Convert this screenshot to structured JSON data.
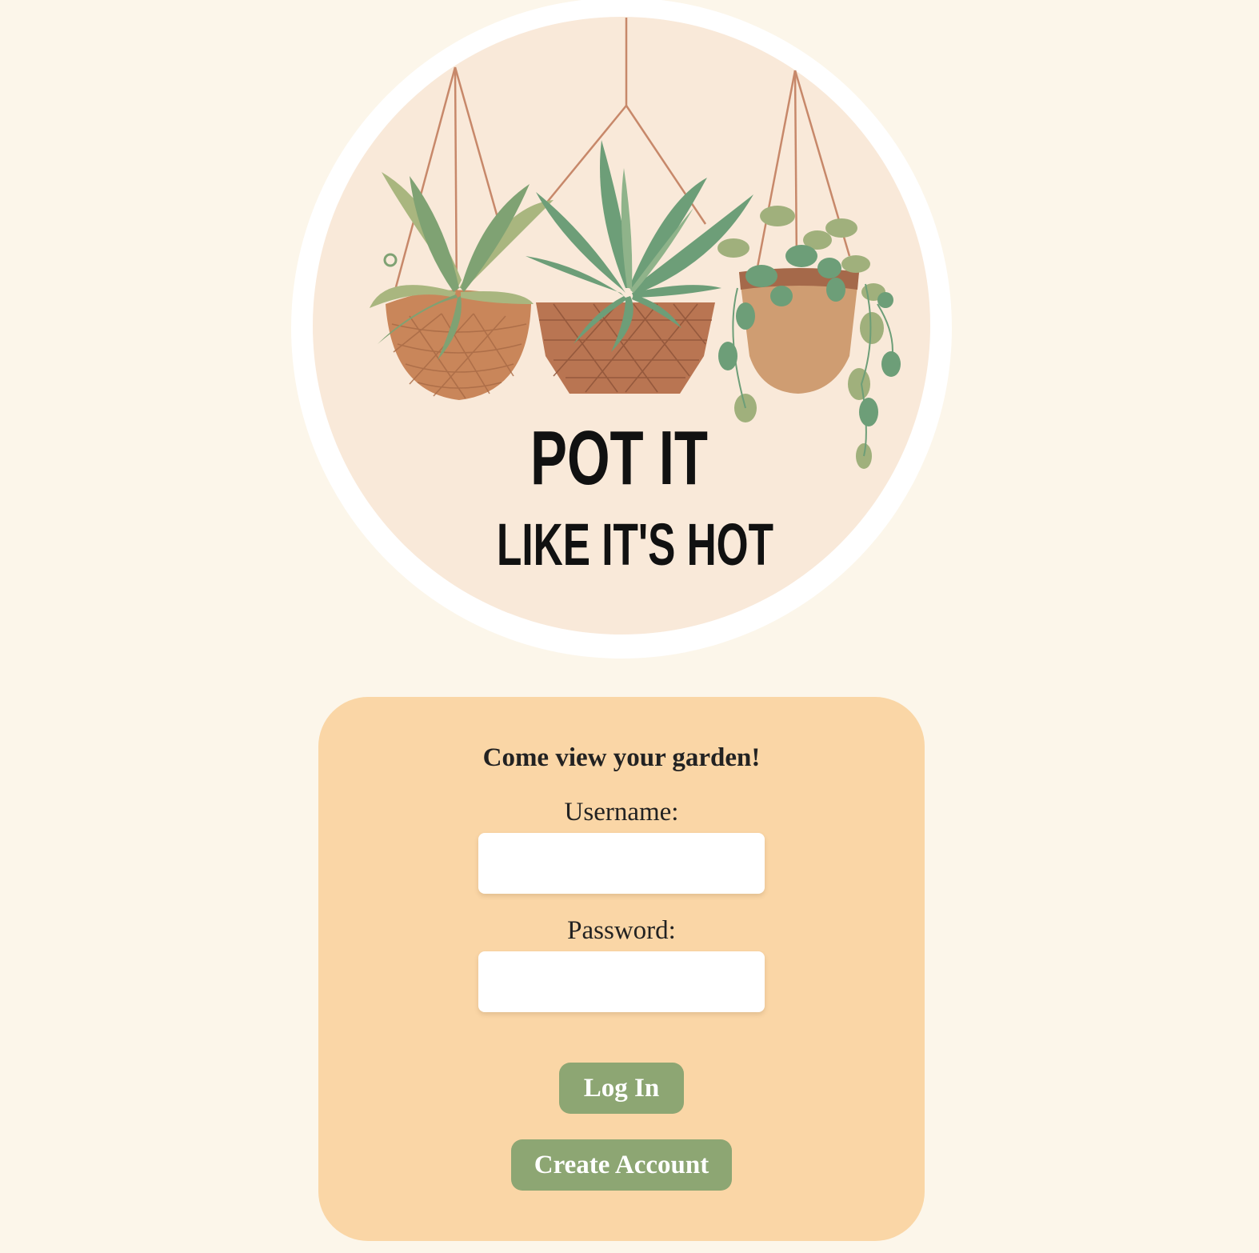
{
  "logo": {
    "title_line1": "POT IT",
    "title_line2": "LIKE IT'S HOT",
    "colors": {
      "outer_ring": "#ffffff",
      "badge": "#f9e9d9",
      "pot": "#c9865a",
      "leaf_dark": "#6d9e78",
      "leaf_light": "#a9b67f"
    }
  },
  "login_form": {
    "heading": "Come view your garden!",
    "username_label": "Username:",
    "username_value": "",
    "password_label": "Password:",
    "password_value": "",
    "login_button": "Log In",
    "create_account_button": "Create Account"
  },
  "colors": {
    "page_background": "#fcf6ea",
    "card_background": "#fad6a6",
    "button_background": "#8da673",
    "button_text": "#ffffff"
  }
}
